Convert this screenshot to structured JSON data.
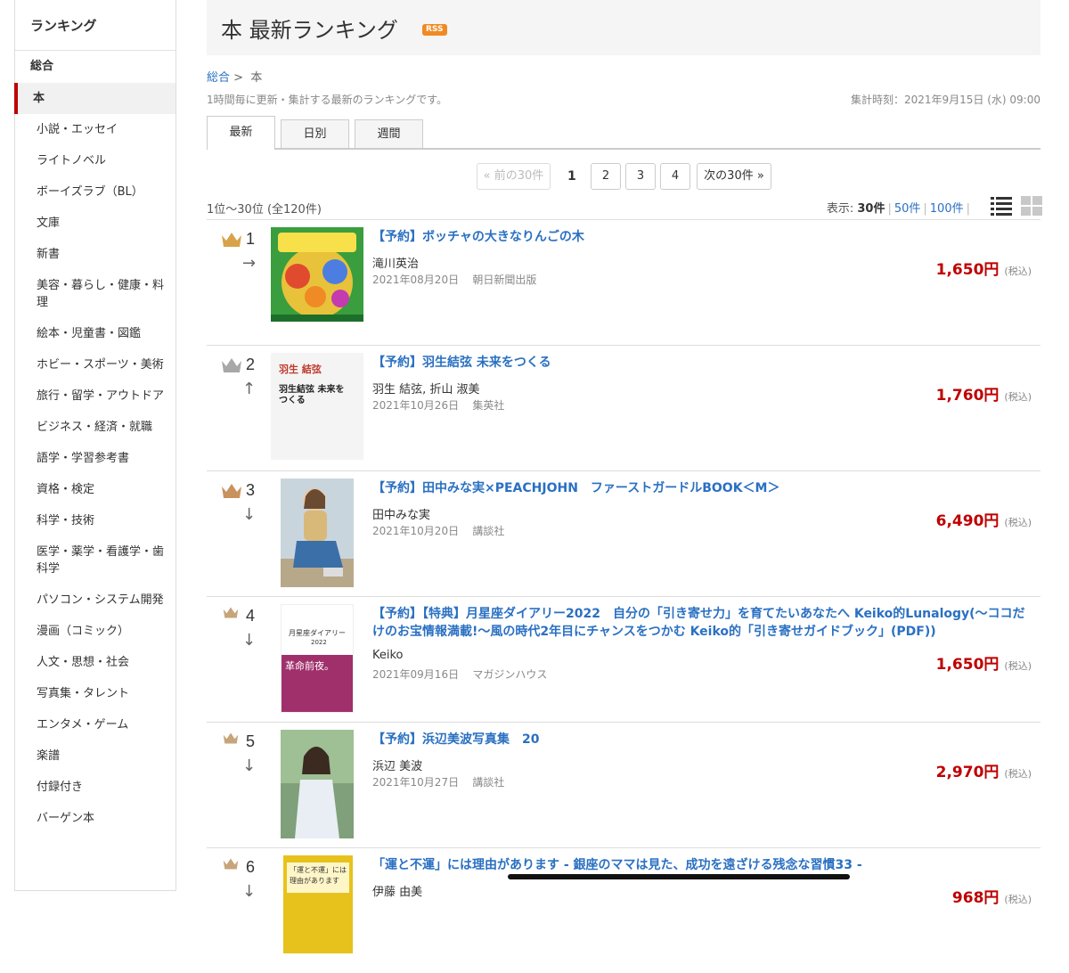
{
  "sidebar": {
    "title": "ランキング",
    "all": "総合",
    "current": "本",
    "items": [
      {
        "label": "小説・エッセイ"
      },
      {
        "label": "ライトノベル"
      },
      {
        "label": "ボーイズラブ（BL）"
      },
      {
        "label": "文庫"
      },
      {
        "label": "新書"
      },
      {
        "label": "美容・暮らし・健康・料理"
      },
      {
        "label": "絵本・児童書・図鑑"
      },
      {
        "label": "ホビー・スポーツ・美術"
      },
      {
        "label": "旅行・留学・アウトドア"
      },
      {
        "label": "ビジネス・経済・就職"
      },
      {
        "label": "語学・学習参考書"
      },
      {
        "label": "資格・検定"
      },
      {
        "label": "科学・技術"
      },
      {
        "label": "医学・薬学・看護学・歯科学"
      },
      {
        "label": "パソコン・システム開発"
      },
      {
        "label": "漫画（コミック）"
      },
      {
        "label": "人文・思想・社会"
      },
      {
        "label": "写真集・タレント"
      },
      {
        "label": "エンタメ・ゲーム"
      },
      {
        "label": "楽譜"
      },
      {
        "label": "付録付き"
      },
      {
        "label": "バーゲン本"
      }
    ]
  },
  "header": {
    "title": "本 最新ランキング",
    "rss_label": "RSS"
  },
  "breadcrumb": {
    "root": "総合",
    "separator": " > ",
    "current": "本"
  },
  "description": "1時間毎に更新・集計する最新のランキングです。",
  "aggregation_time": "集計時刻：2021年9月15日 (水) 09:00",
  "tabs": [
    {
      "label": "最新",
      "active": true
    },
    {
      "label": "日別",
      "active": false
    },
    {
      "label": "週間",
      "active": false
    }
  ],
  "pager": {
    "prev": "« 前の30件",
    "current": "1",
    "pages": [
      "2",
      "3",
      "4"
    ],
    "next": "次の30件 »"
  },
  "range_text": "1位〜30位 (全120件)",
  "display": {
    "label": "表示:",
    "current": "30件",
    "options": [
      "50件",
      "100件"
    ],
    "separator": "|"
  },
  "items": [
    {
      "rank": "1",
      "arrow": "→",
      "crown": "gold",
      "title": "【予約】ボッチャの大きなりんごの木",
      "author": "滝川英治",
      "date": "2021年08月20日",
      "publisher": "朝日新聞出版",
      "price": "1,650円",
      "tax": "(税込)",
      "cover_color": "#2fa34a"
    },
    {
      "rank": "2",
      "arrow": "↑",
      "crown": "silver",
      "title": "【予約】羽生結弦 未来をつくる",
      "author": "羽生 結弦, 折山 淑美",
      "date": "2021年10月26日",
      "publisher": "集英社",
      "price": "1,760円",
      "tax": "(税込)",
      "cover_color": "#f4f4f4",
      "cover_text_1": "羽生 結弦",
      "cover_text_2": "羽生結弦 未来を",
      "cover_text_3": "つくる"
    },
    {
      "rank": "3",
      "arrow": "↓",
      "crown": "bronze",
      "title": "【予約】田中みな実×PEACHJOHN　ファーストガードルBOOK＜M＞",
      "author": "田中みな実",
      "date": "2021年10月20日",
      "publisher": "講談社",
      "price": "6,490円",
      "tax": "(税込)",
      "cover_color": "#8aa3b8"
    },
    {
      "rank": "4",
      "arrow": "↓",
      "crown": "small",
      "title": "【予約】【特典】月星座ダイアリー2022　自分の「引き寄せ力」を育てたいあなたへ Keiko的Lunalogy(〜ココだけのお宝情報満載!〜風の時代2年目にチャンスをつかむ Keiko的「引き寄せガイドブック」(PDF))",
      "author": "Keiko",
      "date": "2021年09月16日",
      "publisher": "マガジンハウス",
      "price": "1,650円",
      "tax": "(税込)",
      "cover_color": "#a0306c",
      "cover_text_1": "月星座ダイアリー",
      "cover_text_2": "2022",
      "cover_text_3": "革命前夜。"
    },
    {
      "rank": "5",
      "arrow": "↓",
      "crown": "small",
      "title": "【予約】浜辺美波写真集　20",
      "author": "浜辺 美波",
      "date": "2021年10月27日",
      "publisher": "講談社",
      "price": "2,970円",
      "tax": "(税込)",
      "cover_color": "#8fae86"
    },
    {
      "rank": "6",
      "arrow": "↓",
      "crown": "small",
      "title": "「運と不運」には理由があります - 銀座のママは見た、成功を遠ざける残念な習慣33 -",
      "author": "伊藤 由美",
      "date": "",
      "publisher": "",
      "price": "968円",
      "tax": "(税込)",
      "cover_color": "#e8c21c",
      "cover_text_1": "「運と不運」には",
      "cover_text_2": "理由があります"
    }
  ],
  "colors": {
    "link": "#2a70c2",
    "price": "#bf0000",
    "accent": "#bf0000",
    "rss": "#f08a24",
    "gold": "#d8a24a",
    "silver": "#a8a8a8",
    "bronze": "#c8925e"
  }
}
